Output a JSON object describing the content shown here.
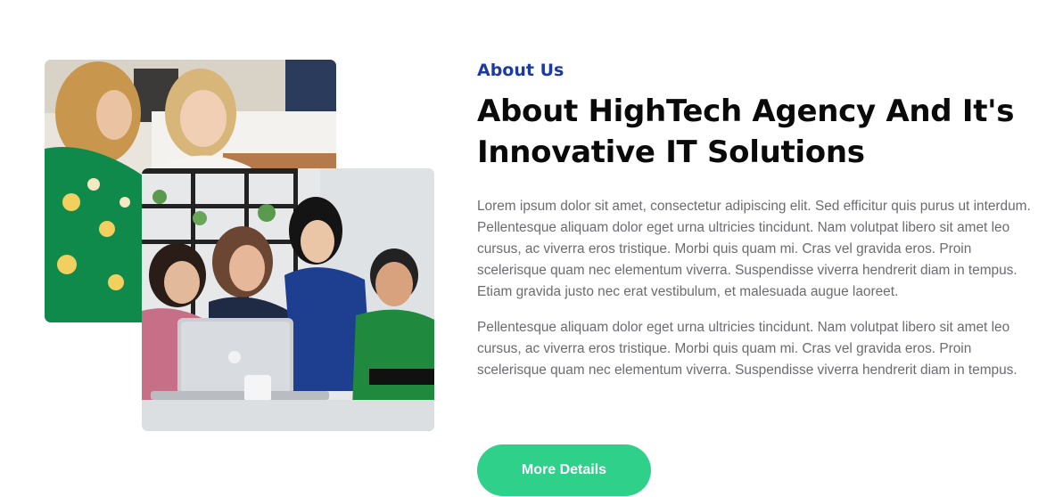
{
  "about": {
    "eyebrow": "About Us",
    "headline": "About HighTech Agency And It's Innovative IT Solutions",
    "paragraph_1": "Lorem ipsum dolor sit amet, consectetur adipiscing elit. Sed efficitur quis purus ut interdum. Pellentesque aliquam dolor eget urna ultricies tincidunt. Nam volutpat libero sit amet leo cursus, ac viverra eros tristique. Morbi quis quam mi. Cras vel gravida eros. Proin scelerisque quam nec elementum viverra. Suspendisse viverra hendrerit diam in tempus. Etiam gravida justo nec erat vestibulum, et malesuada augue laoreet.",
    "paragraph_2": "Pellentesque aliquam dolor eget urna ultricies tincidunt. Nam volutpat libero sit amet leo cursus, ac viverra eros tristique. Morbi quis quam mi. Cras vel gravida eros. Proin scelerisque quam nec elementum viverra. Suspendisse viverra hendrerit diam in tempus.",
    "cta_label": "More Details"
  },
  "colors": {
    "eyebrow": "#1d3a9e",
    "heading": "#0a0a0a",
    "body_text": "#6b6b72",
    "cta_background": "#2fd089",
    "cta_text": "#ffffff"
  }
}
